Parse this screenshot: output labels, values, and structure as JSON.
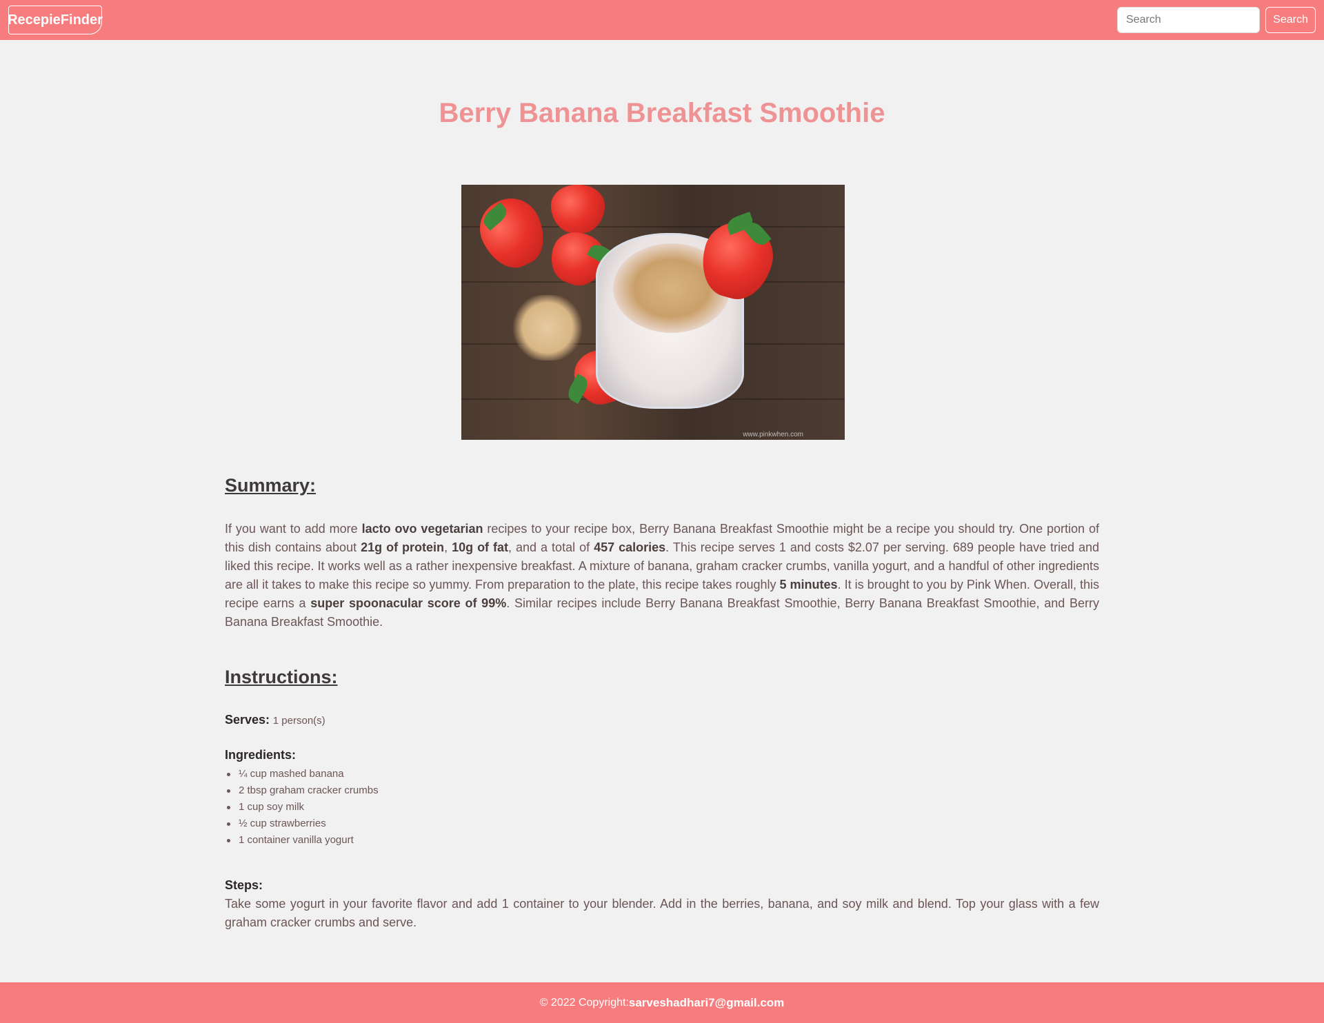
{
  "navbar": {
    "brand": "RecepieFinder",
    "search_placeholder": "Search",
    "search_button": "Search",
    "accent_color": "#f67c7d"
  },
  "recipe": {
    "title": "Berry Banana Breakfast Smoothie",
    "image_alt": "Berry Banana Breakfast Smoothie",
    "image_watermark": "www.pinkwhen.com",
    "summary_heading": "Summary:",
    "summary_parts": [
      {
        "text": "If you want to add more ",
        "bold": false
      },
      {
        "text": "lacto ovo vegetarian",
        "bold": true
      },
      {
        "text": " recipes to your recipe box, Berry Banana Breakfast Smoothie might be a recipe you should try. One portion of this dish contains about ",
        "bold": false
      },
      {
        "text": "21g of protein",
        "bold": true
      },
      {
        "text": ", ",
        "bold": false
      },
      {
        "text": "10g of fat",
        "bold": true
      },
      {
        "text": ", and a total of ",
        "bold": false
      },
      {
        "text": "457 calories",
        "bold": true
      },
      {
        "text": ". This recipe serves 1 and costs $2.07 per serving. 689 people have tried and liked this recipe. It works well as a rather inexpensive breakfast. A mixture of banana, graham cracker crumbs, vanilla yogurt, and a handful of other ingredients are all it takes to make this recipe so yummy. From preparation to the plate, this recipe takes roughly ",
        "bold": false
      },
      {
        "text": "5 minutes",
        "bold": true
      },
      {
        "text": ". It is brought to you by Pink When. Overall, this recipe earns a ",
        "bold": false
      },
      {
        "text": "super spoonacular score of 99%",
        "bold": true
      },
      {
        "text": ". Similar recipes include Berry Banana Breakfast Smoothie, Berry Banana Breakfast Smoothie, and Berry Banana Breakfast Smoothie.",
        "bold": false
      }
    ],
    "instructions_heading": "Instructions:",
    "serves_label": "Serves:",
    "serves_value": "1 person(s)",
    "ingredients_label": "Ingredients:",
    "ingredients": [
      "¼ cup mashed banana",
      "2 tbsp graham cracker crumbs",
      "1 cup soy milk",
      "½ cup strawberries",
      "1 container vanilla yogurt"
    ],
    "steps_label": "Steps:",
    "steps": "Take some yogurt in your favorite flavor and add 1 container to your blender. Add in the berries, banana, and soy milk and blend. Top your glass with a few graham cracker crumbs and serve."
  },
  "footer": {
    "copyright": "© 2022 Copyright:",
    "email": "sarveshadhari7@gmail.com"
  }
}
